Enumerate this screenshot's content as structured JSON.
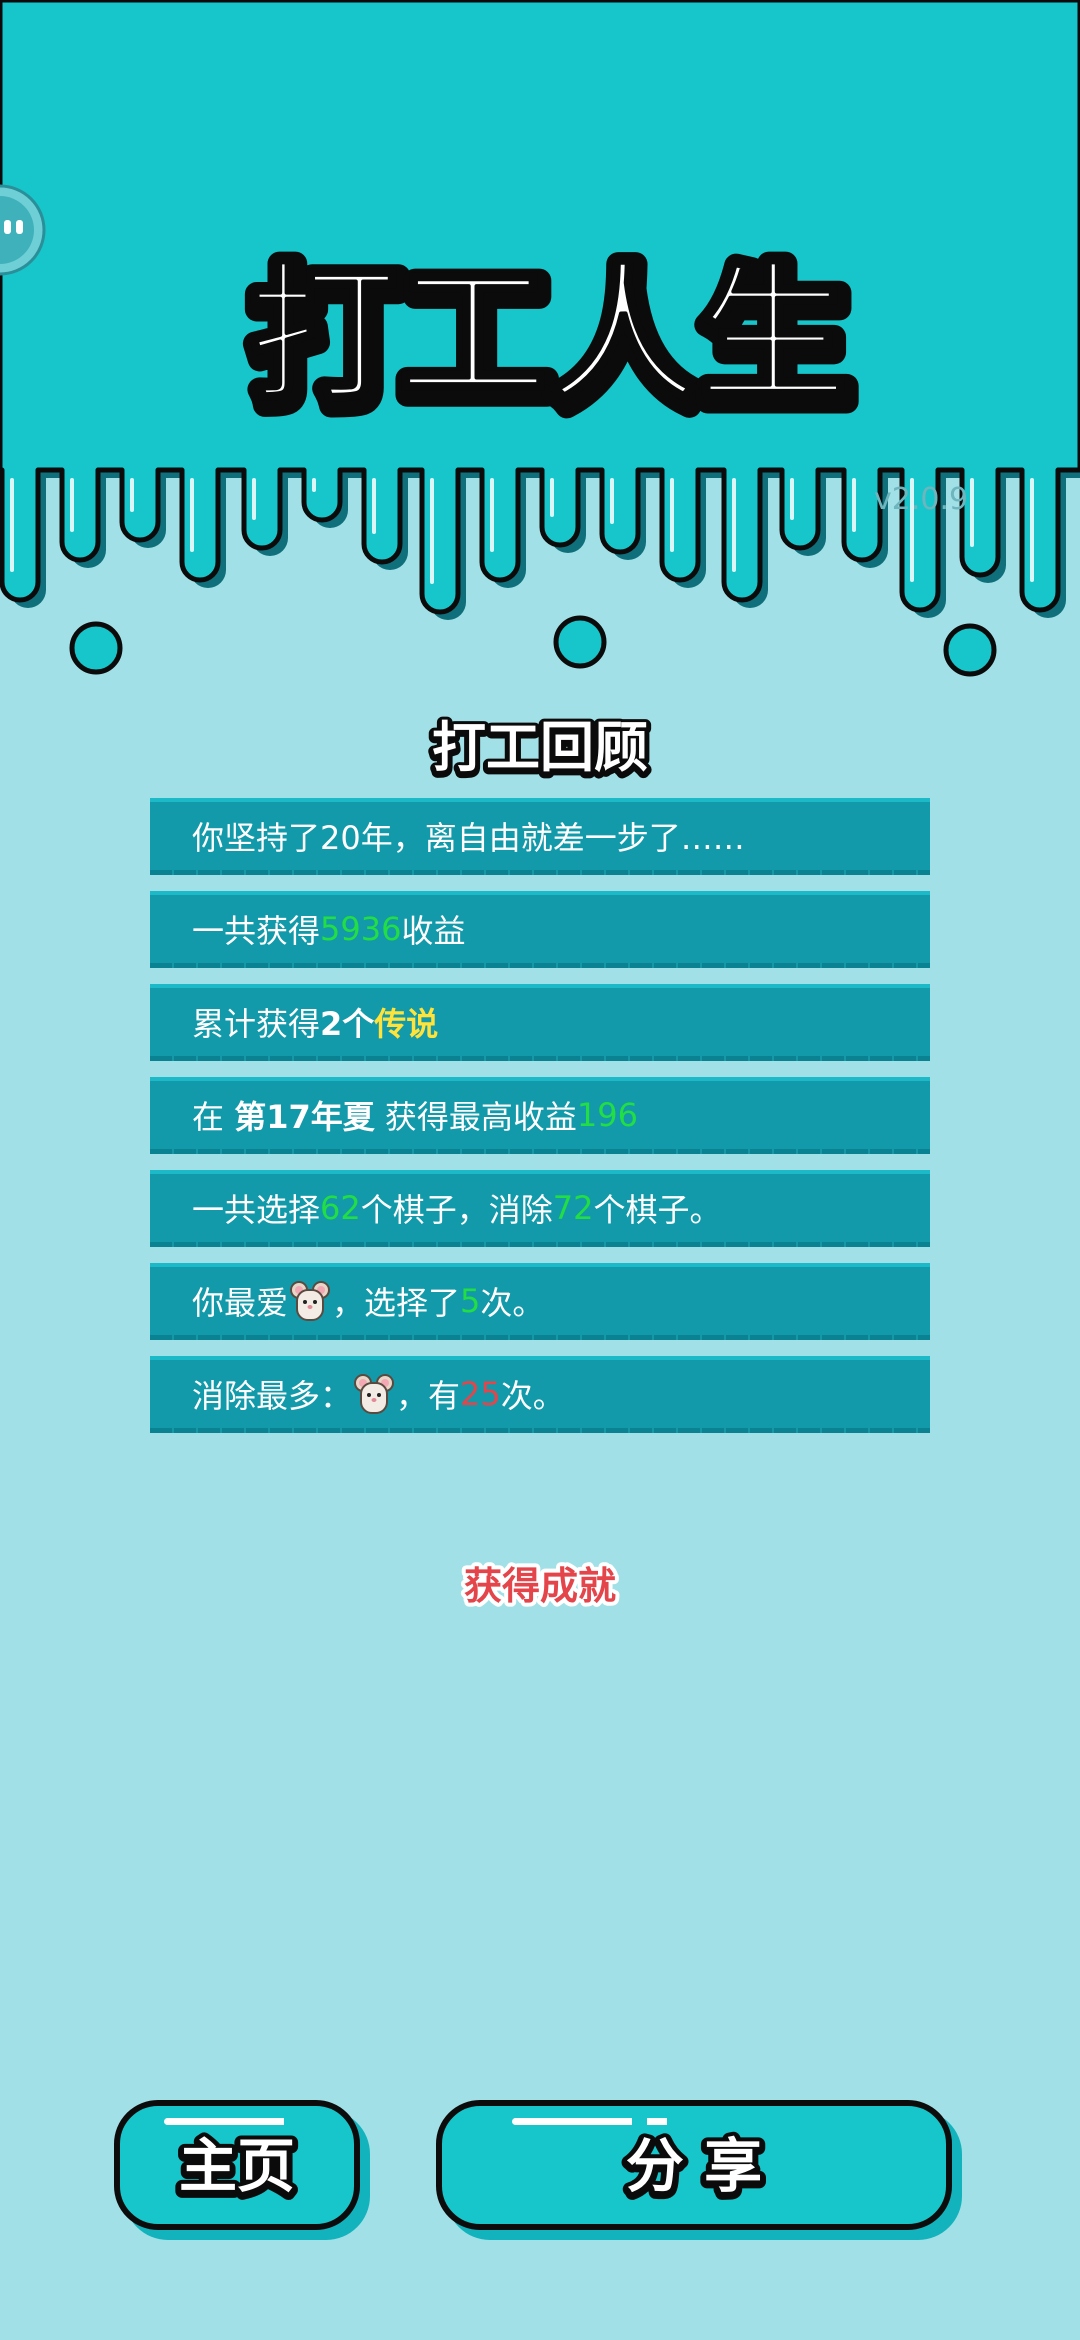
{
  "header": {
    "game_title": "打工人生",
    "version": "v2.0.9"
  },
  "review": {
    "section_title": "打工回顾",
    "rows": [
      {
        "text": "你坚持了20年，离自由就差一步了……"
      },
      {
        "prefix": "一共获得",
        "value": "5936",
        "suffix": "收益"
      },
      {
        "prefix": "累计获得",
        "count": "2个",
        "rarity": "传说"
      },
      {
        "prefix": "在 ",
        "season": "第17年夏",
        "middle": " 获得最高收益",
        "value": "196"
      },
      {
        "prefix": "一共选择",
        "chosen": "62",
        "mid": "个棋子，消除",
        "removed": "72",
        "suffix": "个棋子。"
      },
      {
        "prefix": "你最爱",
        "icon": "mouse-icon",
        "mid": "，选择了",
        "times": "5",
        "suffix": "次。"
      },
      {
        "prefix": "消除最多：",
        "icon": "mouse-icon",
        "mid": "，有",
        "times": "25",
        "suffix": "次。"
      }
    ]
  },
  "achievement_label": "获得成就",
  "buttons": {
    "home": "主页",
    "share": "分 享"
  },
  "colors": {
    "background": "#a1e0e6",
    "header": "#16c6ca",
    "row": "#129aaa",
    "value_green": "#22dd44",
    "legend_yellow": "#ffe23a",
    "highlight_red": "#e4454a"
  }
}
